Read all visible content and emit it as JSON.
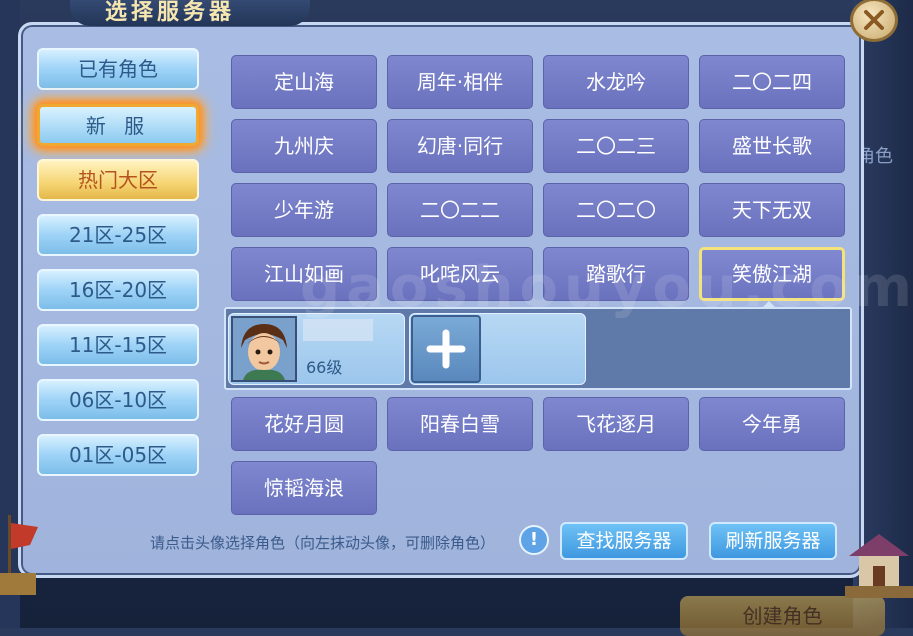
{
  "window": {
    "title": "选择服务器"
  },
  "background": {
    "create_role_label": "创建角色",
    "right_panel_label": "角色"
  },
  "sidebar": {
    "items": [
      {
        "label": "已有角色"
      },
      {
        "label": "新 服"
      },
      {
        "label": "热门大区"
      },
      {
        "label": "21区-25区"
      },
      {
        "label": "16区-20区"
      },
      {
        "label": "11区-15区"
      },
      {
        "label": "06区-10区"
      },
      {
        "label": "01区-05区"
      }
    ],
    "selected": "新 服"
  },
  "servers": [
    {
      "label": "定山海"
    },
    {
      "label": "周年·相伴"
    },
    {
      "label": "水龙吟"
    },
    {
      "label": "二〇二四"
    },
    {
      "label": "九州庆"
    },
    {
      "label": "幻唐·同行"
    },
    {
      "label": "二〇二三"
    },
    {
      "label": "盛世长歌"
    },
    {
      "label": "少年游"
    },
    {
      "label": "二〇二二"
    },
    {
      "label": "二〇二〇"
    },
    {
      "label": "天下无双"
    },
    {
      "label": "江山如画"
    },
    {
      "label": "叱咤风云"
    },
    {
      "label": "踏歌行"
    },
    {
      "label": "笑傲江湖"
    },
    {
      "label": "花好月圆"
    },
    {
      "label": "阳春白雪"
    },
    {
      "label": "飞花逐月"
    },
    {
      "label": "今年勇"
    },
    {
      "label": "惊韬海浪"
    }
  ],
  "selected_server": "笑傲江湖",
  "characters": [
    {
      "level": "66级"
    }
  ],
  "watermark": "gaoshouyou.com",
  "footer": {
    "hint": "请点击头像选择角色（向左抹动头像，可删除角色）",
    "info_icon": "!",
    "find_server_label": "查找服务器",
    "refresh_server_label": "刷新服务器"
  },
  "colors": {
    "panel_bg": "#a9bde4",
    "server_button": "#7f87cf",
    "selected_outline": "#f4e27a",
    "sidebar_button": "#9ed3f7",
    "hot_button": "#f5d472",
    "action_button": "#3f98e0"
  }
}
